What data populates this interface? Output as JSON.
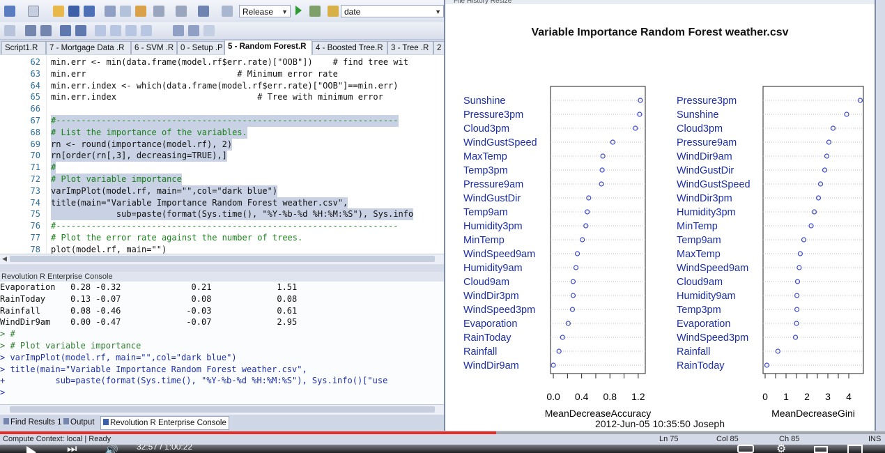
{
  "toolbar": {
    "config_combo": "Release",
    "search_combo": "date"
  },
  "tabs": [
    {
      "label": "Script1.R"
    },
    {
      "label": "7 - Mortgage Data .R"
    },
    {
      "label": "6 - SVM .R"
    },
    {
      "label": "0 - Setup .P"
    },
    {
      "label": "5 - Random Forest.R"
    },
    {
      "label": "4 - Boosted Tree.R"
    },
    {
      "label": "3 - Tree .R"
    },
    {
      "label": "2"
    }
  ],
  "editor": {
    "lines": [
      {
        "n": "62",
        "code": "min.err <- min(data.frame(model.rf$err.rate)[\"OOB\"])    # find tree wit"
      },
      {
        "n": "63",
        "code": "min.err                              # Minimum error rate"
      },
      {
        "n": "64",
        "code": "min.err.index <- which(data.frame(model.rf$err.rate)[\"OOB\"]==min.err)"
      },
      {
        "n": "65",
        "code": "min.err.index                            # Tree with minimum error"
      },
      {
        "n": "66",
        "code": ""
      },
      {
        "n": "67",
        "code": "#--------------------------------------------------------------------"
      },
      {
        "n": "68",
        "code": "# List the importance of the variables."
      },
      {
        "n": "69",
        "code": "rn <- round(importance(model.rf), 2)"
      },
      {
        "n": "70",
        "code": "rn[order(rn[,3], decreasing=TRUE),]"
      },
      {
        "n": "71",
        "code": "#"
      },
      {
        "n": "72",
        "code": "# Plot variable importance"
      },
      {
        "n": "73",
        "code": "varImpPlot(model.rf, main=\"\",col=\"dark blue\")"
      },
      {
        "n": "74",
        "code": "title(main=\"Variable Importance Random Forest weather.csv\","
      },
      {
        "n": "75",
        "code": "             sub=paste(format(Sys.time(), \"%Y-%b-%d %H:%M:%S\"), Sys.info"
      },
      {
        "n": "76",
        "code": "#--------------------------------------------------------------------"
      },
      {
        "n": "77",
        "code": "# Plot the error rate against the number of trees."
      },
      {
        "n": "78",
        "code": "plot(model.rf, main=\"\")"
      }
    ]
  },
  "console": {
    "title": "Revolution R Enterprise Console",
    "lines": [
      "Evaporation   0.28 -0.32              0.21             1.51",
      "RainToday     0.13 -0.07              0.08             0.08",
      "Rainfall      0.08 -0.46             -0.03             0.61",
      "WindDir9am    0.00 -0.47             -0.07             2.95",
      "> #",
      "> # Plot variable importance",
      "> varImpPlot(model.rf, main=\"\",col=\"dark blue\")",
      "> title(main=\"Variable Importance Random Forest weather.csv\",",
      "+          sub=paste(format(Sys.time(), \"%Y-%b-%d %H:%M:%S\"), Sys.info()[\"use",
      ">"
    ]
  },
  "bottom_tabs": [
    "Find Results 1",
    "Output",
    "Revolution R Enterprise Console"
  ],
  "status": {
    "context": "Compute Context: local  |  Ready",
    "ln": "Ln 75",
    "col": "Col 85",
    "ch": "Ch 85",
    "ins": "INS"
  },
  "video": {
    "time": "32:57 / 1:00:22",
    "progress": 0.561
  },
  "plot_window": {
    "menu": "File   History   Resize"
  },
  "chart_data": [
    {
      "type": "scatter",
      "title": "Variable Importance Random Forest weather.csv",
      "subtitle": "2012-Jun-05 10:35:50 Joseph",
      "xlabel": "MeanDecreaseAccuracy",
      "xticks": [
        "0.0",
        "0.4",
        "0.8",
        "1.2"
      ],
      "xlim": [
        -0.04,
        1.3
      ],
      "categories": [
        "Sunshine",
        "Pressure3pm",
        "Cloud3pm",
        "WindGustSpeed",
        "MaxTemp",
        "Temp3pm",
        "Pressure9am",
        "WindGustDir",
        "Temp9am",
        "Humidity3pm",
        "MinTemp",
        "WindSpeed9am",
        "Humidity9am",
        "Cloud9am",
        "WindDir3pm",
        "WindSpeed3pm",
        "Evaporation",
        "RainToday",
        "Rainfall",
        "WindDir9am"
      ],
      "values": [
        1.23,
        1.22,
        1.16,
        0.84,
        0.7,
        0.69,
        0.68,
        0.5,
        0.48,
        0.46,
        0.41,
        0.34,
        0.32,
        0.28,
        0.28,
        0.27,
        0.21,
        0.13,
        0.08,
        0.0
      ]
    },
    {
      "type": "scatter",
      "xlabel": "MeanDecreaseGini",
      "xticks": [
        "0",
        "1",
        "2",
        "3",
        "4"
      ],
      "xlim": [
        -0.1,
        4.7
      ],
      "categories": [
        "Pressure3pm",
        "Sunshine",
        "Cloud3pm",
        "Pressure9am",
        "WindDir9am",
        "WindGustDir",
        "WindGustSpeed",
        "WindDir3pm",
        "Humidity3pm",
        "MinTemp",
        "Temp9am",
        "MaxTemp",
        "WindSpeed9am",
        "Cloud9am",
        "Humidity9am",
        "Temp3pm",
        "Evaporation",
        "WindSpeed3pm",
        "Rainfall",
        "RainToday"
      ],
      "values": [
        4.55,
        3.9,
        3.25,
        3.05,
        2.95,
        2.85,
        2.65,
        2.55,
        2.35,
        2.2,
        1.85,
        1.68,
        1.63,
        1.55,
        1.52,
        1.52,
        1.5,
        1.45,
        0.61,
        0.08
      ]
    }
  ]
}
